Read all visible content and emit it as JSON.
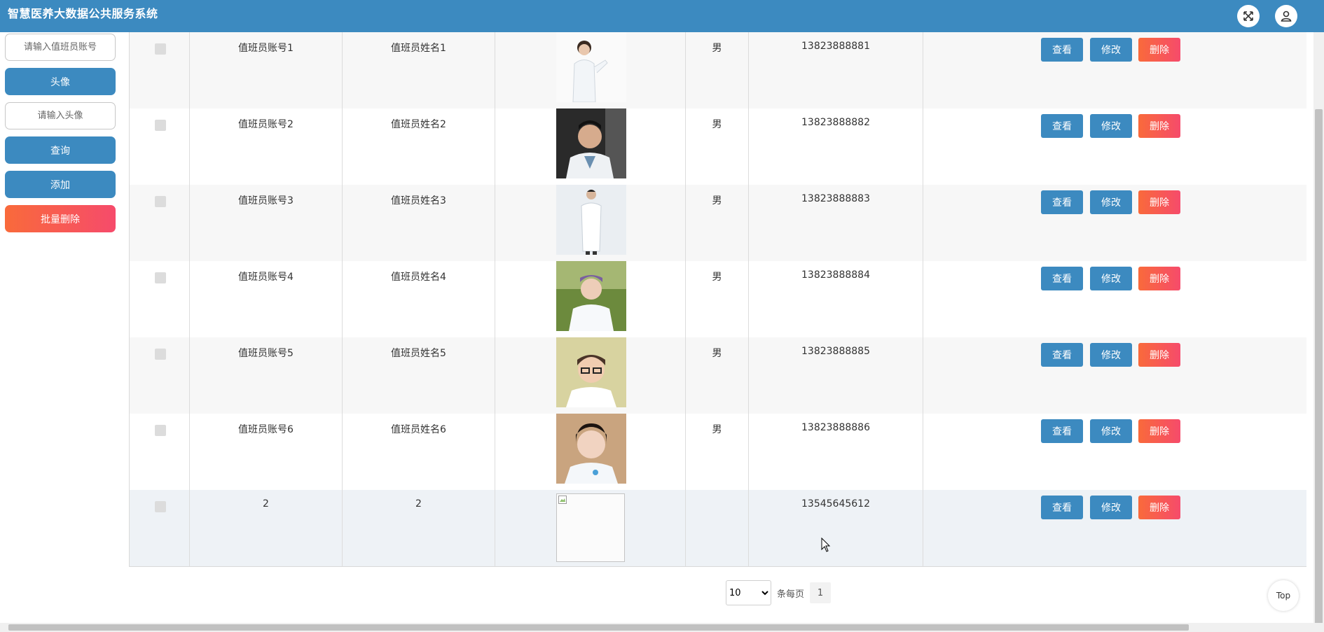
{
  "header": {
    "title": "智慧医养大数据公共服务系统",
    "fullscreen_icon": "expand-icon",
    "user_icon": "user-icon"
  },
  "sidebar": {
    "account_placeholder": "请输入值班员账号",
    "avatar_label": "头像",
    "avatar_placeholder": "请输入头像",
    "search_label": "查询",
    "add_label": "添加",
    "batch_delete_label": "批量删除"
  },
  "actions": {
    "view": "查看",
    "edit": "修改",
    "delete": "删除"
  },
  "rows": [
    {
      "account": "值班员账号1",
      "name": "值班员姓名1",
      "gender": "男",
      "phone": "13823888881",
      "photo": "doctor-female-white-coat"
    },
    {
      "account": "值班员账号2",
      "name": "值班员姓名2",
      "gender": "男",
      "phone": "13823888882",
      "photo": "doctor-male-dark-background"
    },
    {
      "account": "值班员账号3",
      "name": "值班员姓名3",
      "gender": "男",
      "phone": "13823888883",
      "photo": "doctor-male-full-body"
    },
    {
      "account": "值班员账号4",
      "name": "值班员姓名4",
      "gender": "男",
      "phone": "13823888884",
      "photo": "nurse-outdoor"
    },
    {
      "account": "值班员账号5",
      "name": "值班员姓名5",
      "gender": "男",
      "phone": "13823888885",
      "photo": "doctor-glasses-yellow-background"
    },
    {
      "account": "值班员账号6",
      "name": "值班员姓名6",
      "gender": "男",
      "phone": "13823888886",
      "photo": "nurse-portrait"
    },
    {
      "account": "2",
      "name": "2",
      "gender": "",
      "phone": "13545645612",
      "photo": "broken-image"
    }
  ],
  "pagination": {
    "page_size": "10",
    "page_size_label": "条每页",
    "current_page": "1"
  },
  "back_to_top": "Top",
  "colors": {
    "primary": "#3c8ac0",
    "danger": "#f8575c"
  }
}
